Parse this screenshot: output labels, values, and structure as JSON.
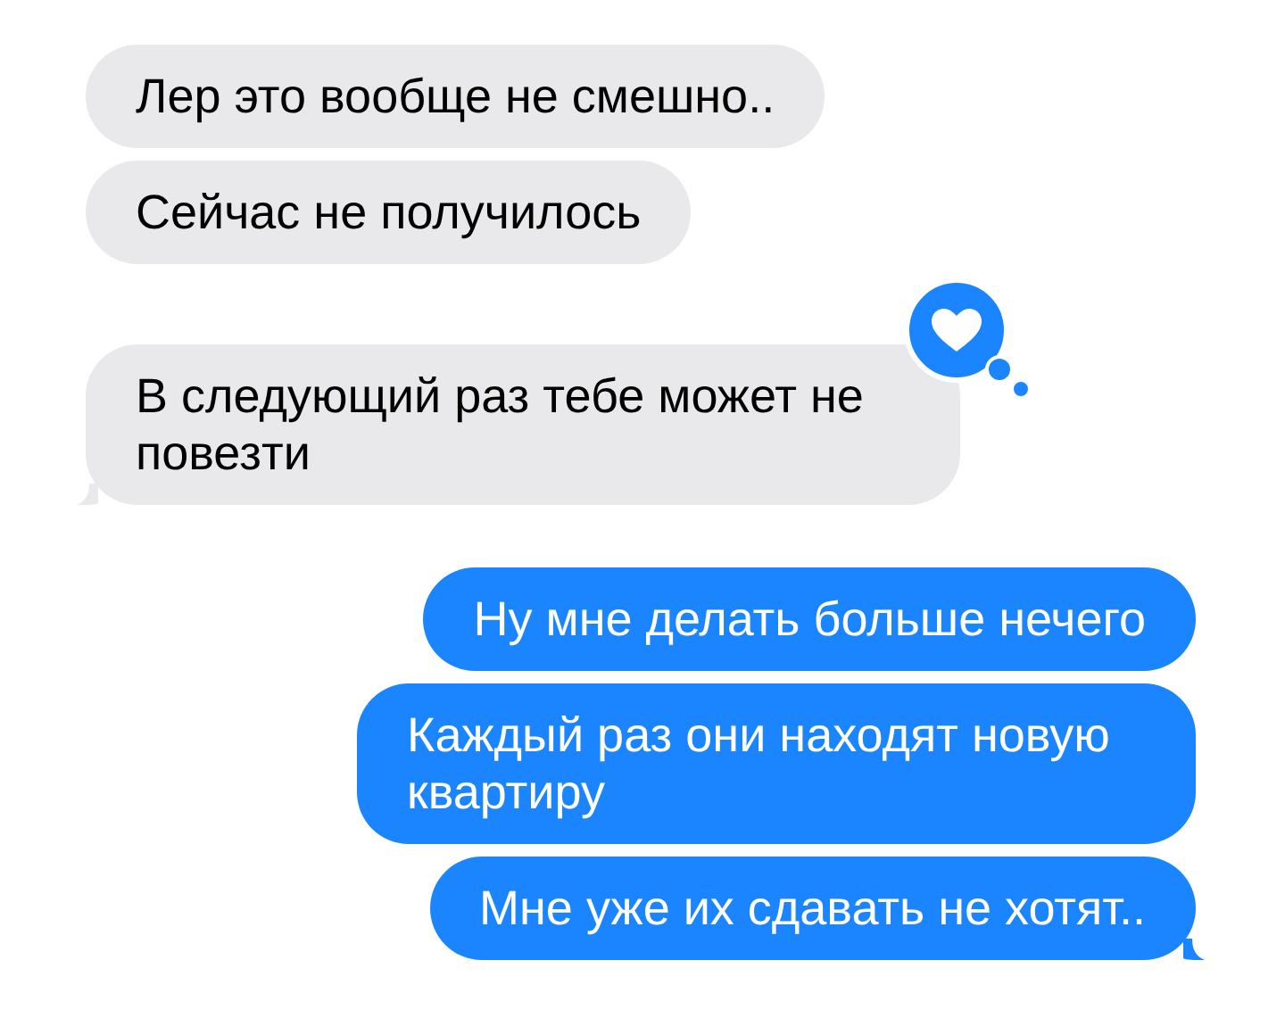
{
  "messages": [
    {
      "kind": "received",
      "text": "Лер это вообще не смешно..",
      "tail": false
    },
    {
      "kind": "received",
      "text": "Сейчас не получилось",
      "tail": false
    },
    {
      "kind": "received",
      "text": "В следующий раз тебе может не повезти",
      "tail": true,
      "reaction": {
        "kind": "heart"
      }
    },
    {
      "kind": "sent",
      "text": "Ну мне делать больше нечего",
      "tail": false
    },
    {
      "kind": "sent",
      "text": "Каждый раз они находят новую квартиру",
      "tail": false
    },
    {
      "kind": "sent",
      "text": "Мне уже их сдавать не хотят..",
      "tail": true
    }
  ]
}
